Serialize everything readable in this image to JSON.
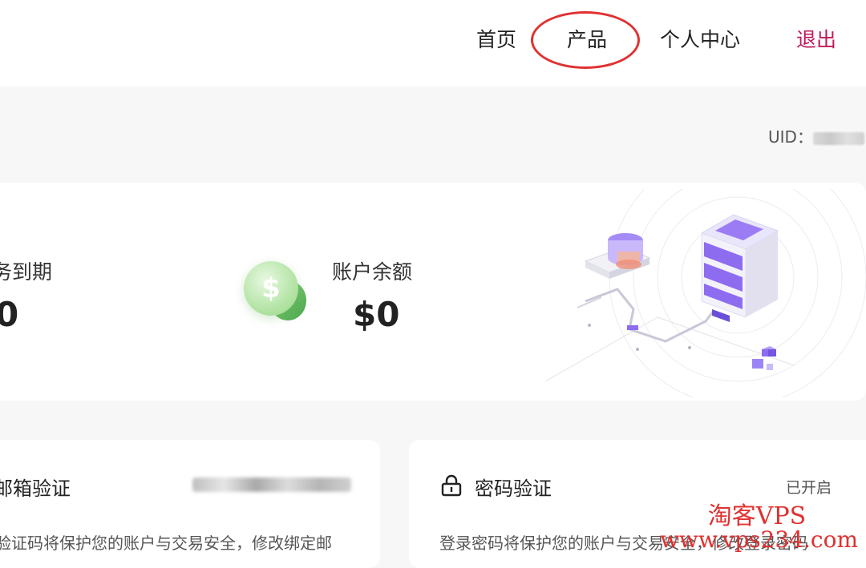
{
  "nav": {
    "items": [
      {
        "label": "首页"
      },
      {
        "label": "产品"
      },
      {
        "label": "个人中心"
      }
    ],
    "logout_label": "退出",
    "logout_color": "#c2185b"
  },
  "header": {
    "uid_label": "UID："
  },
  "summary": {
    "expire_label": "务到期",
    "expire_value": "0",
    "balance_label": "账户余额",
    "balance_value": "$0",
    "coin_symbol": "$"
  },
  "security": {
    "email": {
      "title": "邮箱验证",
      "description": "验证码将保护您的账户与交易安全，修改绑定邮"
    },
    "password": {
      "title": "密码验证",
      "status": "已开启",
      "description": "登录密码将保护您的账户与交易安全，修改登录密码"
    }
  },
  "watermark": {
    "line1": "淘客VPS",
    "line2": "www.vps234.com"
  },
  "colors": {
    "annotation_ring": "#e03131",
    "coin_green": "#8ad27a",
    "server_purple": "#8e6cf0"
  }
}
